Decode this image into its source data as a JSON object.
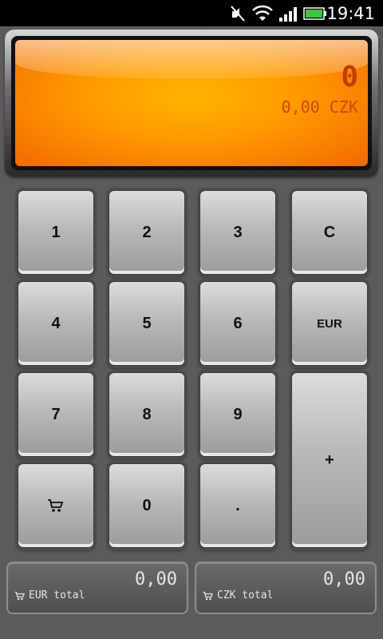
{
  "status_bar": {
    "time": "19:41",
    "icons": [
      "mute-icon",
      "wifi-icon",
      "signal-icon",
      "battery-icon"
    ]
  },
  "display": {
    "value": "0",
    "converted": "0,00 CZK"
  },
  "keypad": {
    "k1": "1",
    "k2": "2",
    "k3": "3",
    "clear": "C",
    "k4": "4",
    "k5": "5",
    "k6": "6",
    "currency": "EUR",
    "k7": "7",
    "k8": "8",
    "k9": "9",
    "plus": "+",
    "k0": "0",
    "dot": ".",
    "cart_icon": "cart-icon"
  },
  "totals": {
    "eur": {
      "value": "0,00",
      "label": "EUR total"
    },
    "czk": {
      "value": "0,00",
      "label": "CZK total"
    }
  },
  "colors": {
    "display_orange": "#ff9800",
    "display_text": "#c23d00",
    "background": "#5b5b5b"
  }
}
